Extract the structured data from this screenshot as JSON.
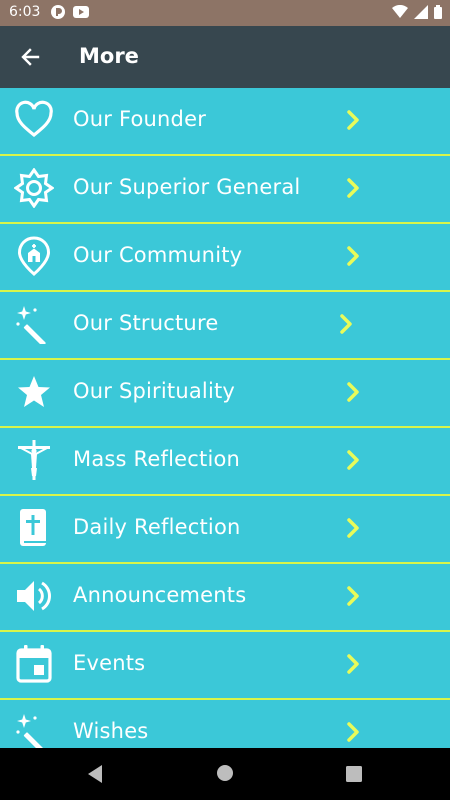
{
  "status_bar": {
    "time": "6:03",
    "left_icons": [
      "notification-app-icon",
      "youtube-icon"
    ],
    "right_icons": [
      "wifi-icon",
      "signal-icon",
      "battery-icon"
    ]
  },
  "app_bar": {
    "title": "More",
    "back_icon": "arrow-back-icon"
  },
  "menu": [
    {
      "label": "Our Founder",
      "icon": "heart-icon"
    },
    {
      "label": "Our Superior General",
      "icon": "badge-gear-icon"
    },
    {
      "label": "Our Community",
      "icon": "church-pin-icon"
    },
    {
      "label": "Our Structure",
      "icon": "magic-wand-icon"
    },
    {
      "label": "Our Spirituality",
      "icon": "star-icon"
    },
    {
      "label": "Mass Reflection",
      "icon": "crucifix-icon"
    },
    {
      "label": "Daily Reflection",
      "icon": "bible-icon"
    },
    {
      "label": "Announcements",
      "icon": "speaker-icon"
    },
    {
      "label": "Events",
      "icon": "calendar-icon"
    },
    {
      "label": "Wishes",
      "icon": "magic-wand-icon"
    }
  ],
  "colors": {
    "list_background": "#3bc8d8",
    "divider": "#d8f54a",
    "chevron": "#e8fb5a",
    "app_bar": "#37474f",
    "status_bar": "#8d7466"
  },
  "nav_bar": {
    "icons": [
      "nav-back-icon",
      "nav-home-icon",
      "nav-recents-icon"
    ]
  }
}
